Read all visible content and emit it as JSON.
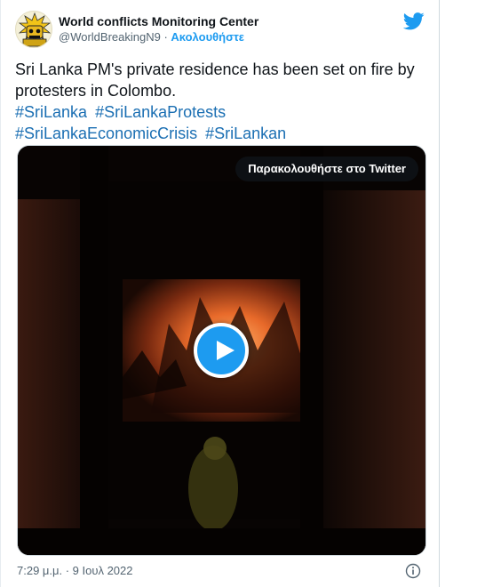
{
  "account": {
    "display_name": "World conflicts Monitoring Center",
    "handle": "@WorldBreakingN9",
    "separator": " · ",
    "follow_label": "Ακολουθήστε"
  },
  "tweet": {
    "text": "Sri Lanka PM's private residence has been set on fire by protesters in Colombo.",
    "hashtags": [
      "#SriLanka",
      "#SriLankaProtests",
      "#SriLankaEconomicCrisis",
      "#SriLankan"
    ]
  },
  "media": {
    "watch_label": "Παρακολουθήστε στο Twitter",
    "play_icon": "play-icon"
  },
  "footer": {
    "timestamp": "7:29 μ.μ. · 9 Ιουλ 2022",
    "info_icon": "info-icon"
  },
  "colors": {
    "accent": "#1d9bf0",
    "hashtag": "#1b6fb3",
    "secondary_text": "#536471"
  }
}
